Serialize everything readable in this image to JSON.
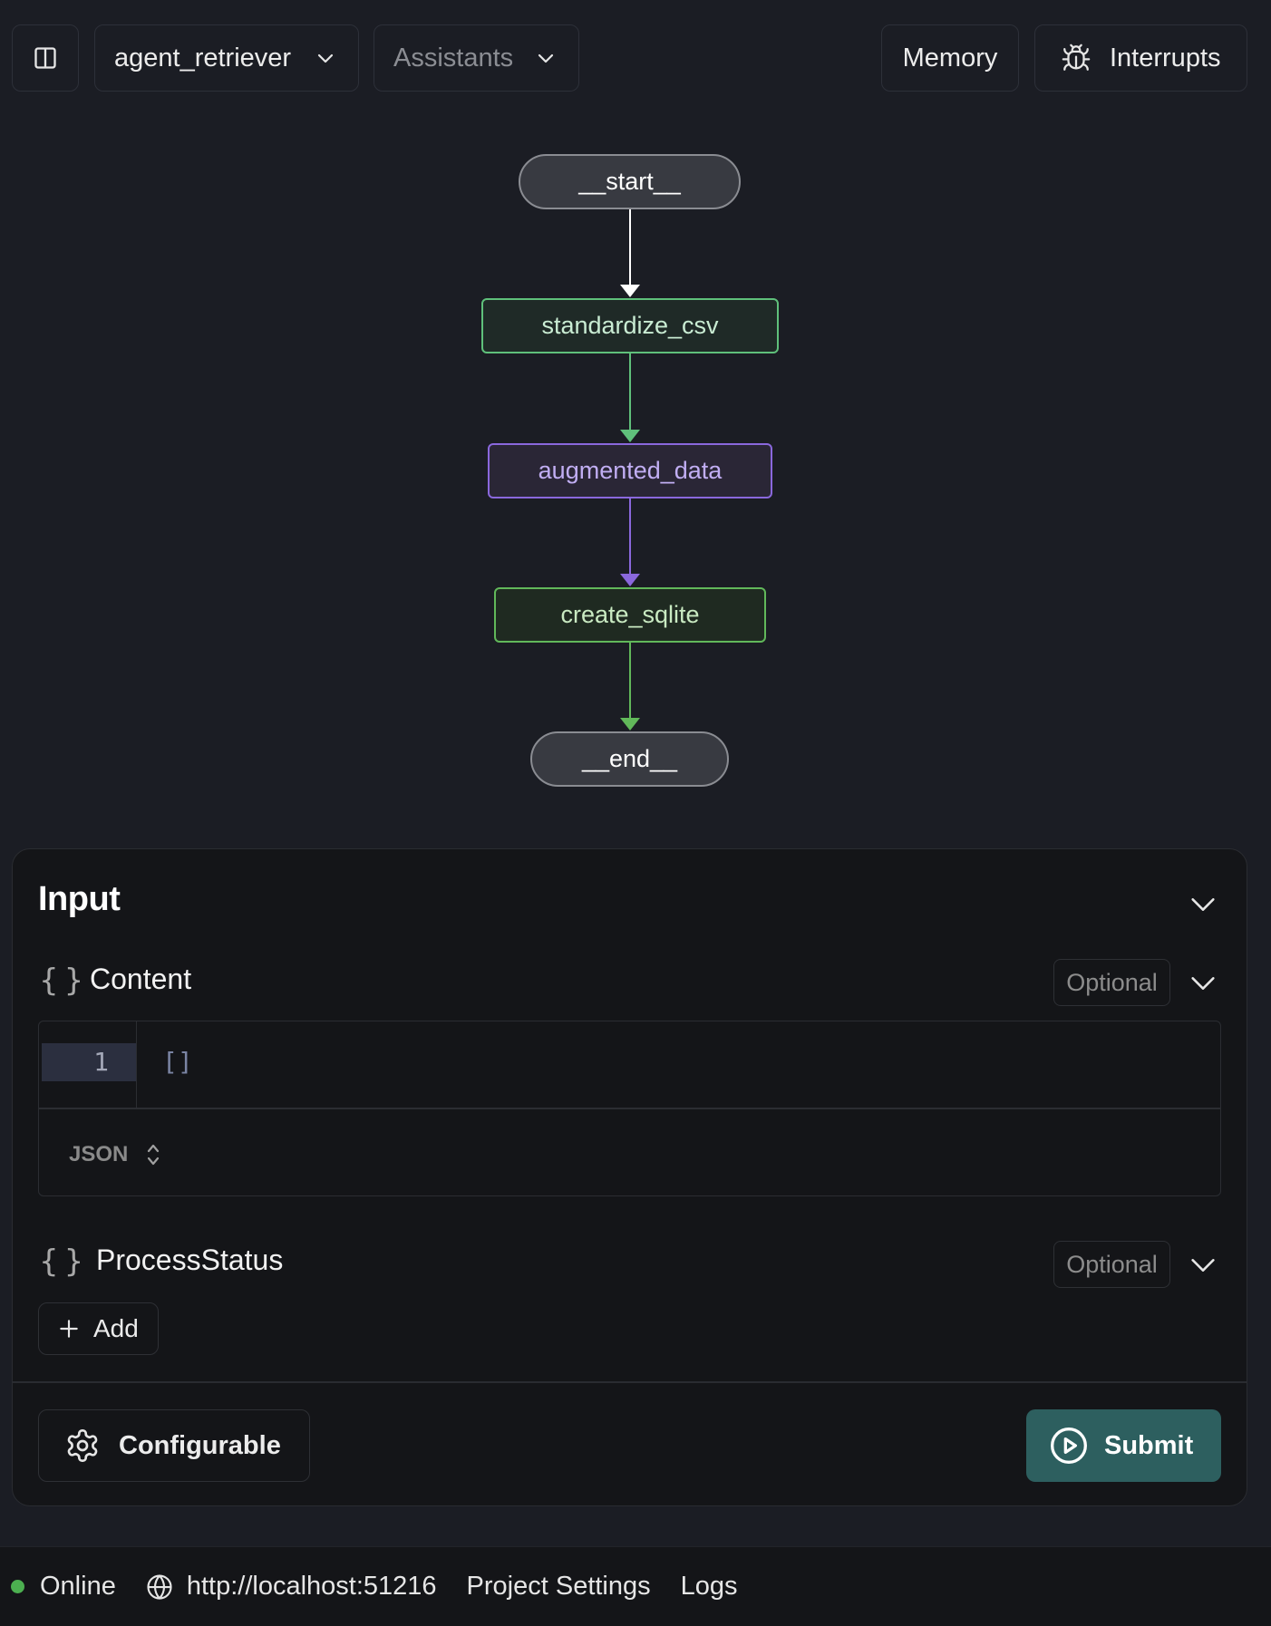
{
  "toolbar": {
    "graph_select": "agent_retriever",
    "assistants_select": "Assistants",
    "memory_label": "Memory",
    "interrupts_label": "Interrupts"
  },
  "graph": {
    "nodes": [
      "__start__",
      "standardize_csv",
      "augmented_data",
      "create_sqlite",
      "__end__"
    ],
    "colors": {
      "start_edge": "#ffffff",
      "standardize_edge": "#5fc07b",
      "augmented_edge": "#8a68dd",
      "sqlite_edge": "#61b85a"
    }
  },
  "input_panel": {
    "title": "Input",
    "fields": [
      {
        "label": "Content",
        "badge": "Optional",
        "icon": "braces-icon"
      },
      {
        "label": "ProcessStatus",
        "badge": "Optional",
        "icon": "braces-icon"
      }
    ],
    "editor": {
      "line_number": "1",
      "code": "[]",
      "language": "JSON"
    },
    "add_label": "Add",
    "configurable_label": "Configurable",
    "submit_label": "Submit"
  },
  "footer": {
    "status": "Online",
    "url": "http://localhost:51216",
    "project_settings": "Project Settings",
    "logs": "Logs"
  },
  "colors": {
    "background": "#1b1d24",
    "panel": "#141518",
    "submit": "#2d5f5f",
    "online": "#4caf50"
  }
}
